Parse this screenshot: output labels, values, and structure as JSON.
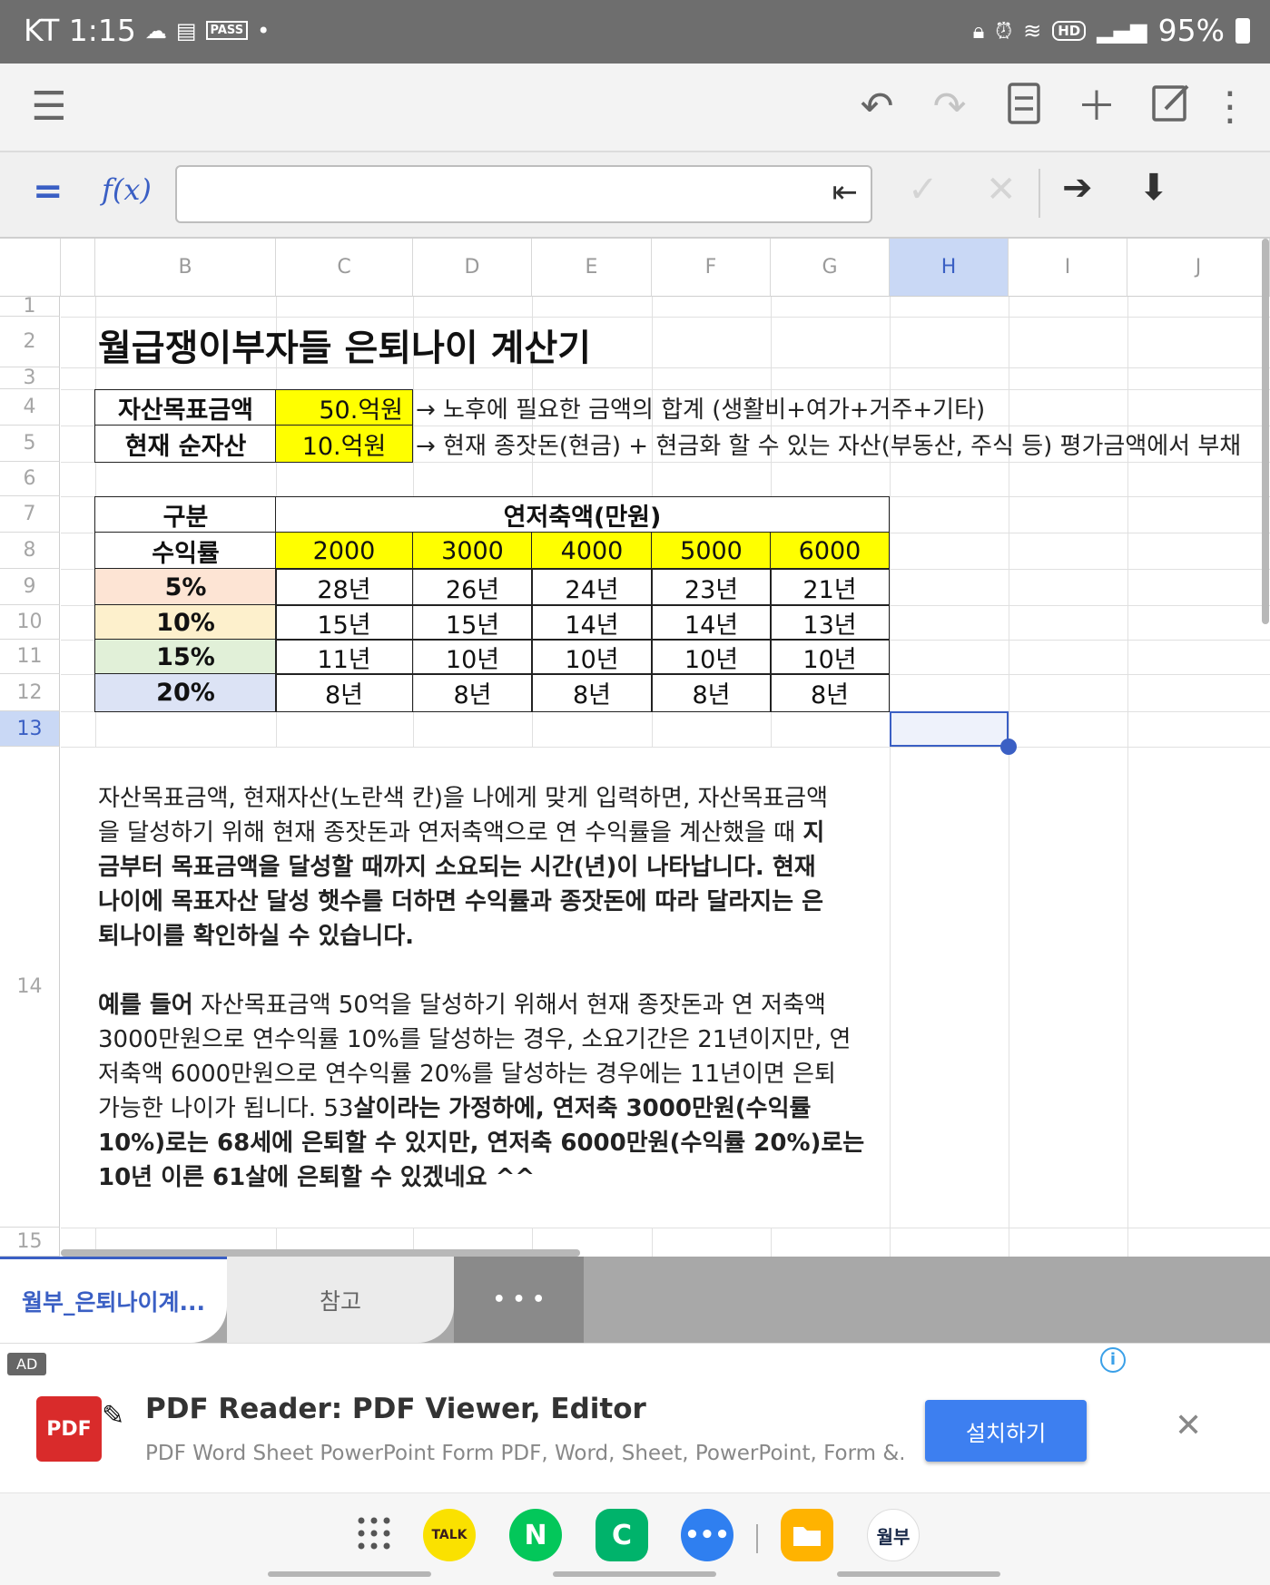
{
  "status_bar": {
    "carrier_time": "KT 1:15",
    "pass_label": "PASS",
    "hd_label": "HD",
    "battery": "95%"
  },
  "toolbar": {
    "icons": [
      "menu-icon",
      "undo-icon",
      "redo-icon",
      "sheet-icon",
      "add-icon",
      "edit-icon",
      "more-icon"
    ]
  },
  "formula_bar": {
    "equals": "=",
    "fx": "f(x)",
    "value": ""
  },
  "grid": {
    "columns": [
      "B",
      "C",
      "D",
      "E",
      "F",
      "G",
      "H",
      "I",
      "J"
    ],
    "rows": [
      "1",
      "2",
      "3",
      "4",
      "5",
      "6",
      "7",
      "8",
      "9",
      "10",
      "11",
      "12",
      "13",
      "14",
      "15"
    ],
    "title": "월급쟁이부자들 은퇴나이 계산기",
    "target_label": "자산목표금액",
    "target_value": "50.억원",
    "target_note": "→ 노후에 필요한 금액의 합계 (생활비+여가+거주+기타)",
    "current_label": "현재 순자산",
    "current_value": "10.억원",
    "current_note": "→ 현재 종잣돈(현금) + 현금화 할 수 있는 자산(부동산, 주식 등) 평가금액에서 부채",
    "table": {
      "corner_top": "구분",
      "corner_bottom": "수익률",
      "savings_header": "연저축액(만원)",
      "savings": [
        "2000",
        "3000",
        "4000",
        "5000",
        "6000"
      ],
      "rows": [
        {
          "rate": "5%",
          "color": "#fde4d4",
          "years": [
            "28년",
            "26년",
            "24년",
            "23년",
            "21년"
          ]
        },
        {
          "rate": "10%",
          "color": "#fdf0cc",
          "years": [
            "15년",
            "15년",
            "14년",
            "14년",
            "13년"
          ]
        },
        {
          "rate": "15%",
          "color": "#e1f0d8",
          "years": [
            "11년",
            "10년",
            "10년",
            "10년",
            "10년"
          ]
        },
        {
          "rate": "20%",
          "color": "#dce3f5",
          "years": [
            "8년",
            "8년",
            "8년",
            "8년",
            "8년"
          ]
        }
      ]
    },
    "desc1_line1": "자산목표금액, 현재자산(노란색 칸)을 나에게 맞게 입력하면, 자산목표금액",
    "desc1_line2_normal": "을 달성하기 위해 현재 종잣돈과 연저축액으로 연 수익률을 계산했을 때 ",
    "desc1_line2_bold": "지",
    "desc1_line3": "금부터 목표금액을 달성할 때까지 소요되는 시간(년)이 나타납니다. 현재",
    "desc1_line4": "나이에 목표자산 달성 햇수를 더하면 수익률과 종잣돈에 따라 달라지는 은",
    "desc1_line5": "퇴나이를 확인하실 수 있습니다.",
    "desc2_line1_bold": "예를 들어",
    "desc2_line1_normal": " 자산목표금액 50억을 달성하기 위해서 현재 종잣돈과 연 저축액",
    "desc2_line2": "3000만원으로 연수익률 10%를 달성하는 경우, 소요기간은 21년이지만, 연",
    "desc2_line3": "저축액 6000만원으로 연수익률 20%를 달성하는 경우에는 11년이면 은퇴",
    "desc2_line4_normal": "가능한 나이가 됩니다. 53",
    "desc2_line4_bold": "살이라는 가정하에, 연저축 3000만원(수익률",
    "desc2_line5": "10%)로는 68세에 은퇴할 수 있지만, 연저축 6000만원(수익률 20%)로는",
    "desc2_line6": "10년 이른 61살에 은퇴할 수 있겠네요 ^^"
  },
  "sheet_tabs": {
    "active": "월부_은퇴나이계...",
    "second": "참고",
    "more": "• • •"
  },
  "ad": {
    "badge": "AD",
    "app_icon_text": "PDF",
    "title": "PDF Reader: PDF Viewer, Editor",
    "subtitle": "PDF Word Sheet PowerPoint Form PDF, Word, Sheet, PowerPoint, Form &...",
    "install": "설치하기"
  },
  "dock": {
    "talk": "TALK",
    "naver": "N",
    "c": "C",
    "wolbu": "월부"
  }
}
